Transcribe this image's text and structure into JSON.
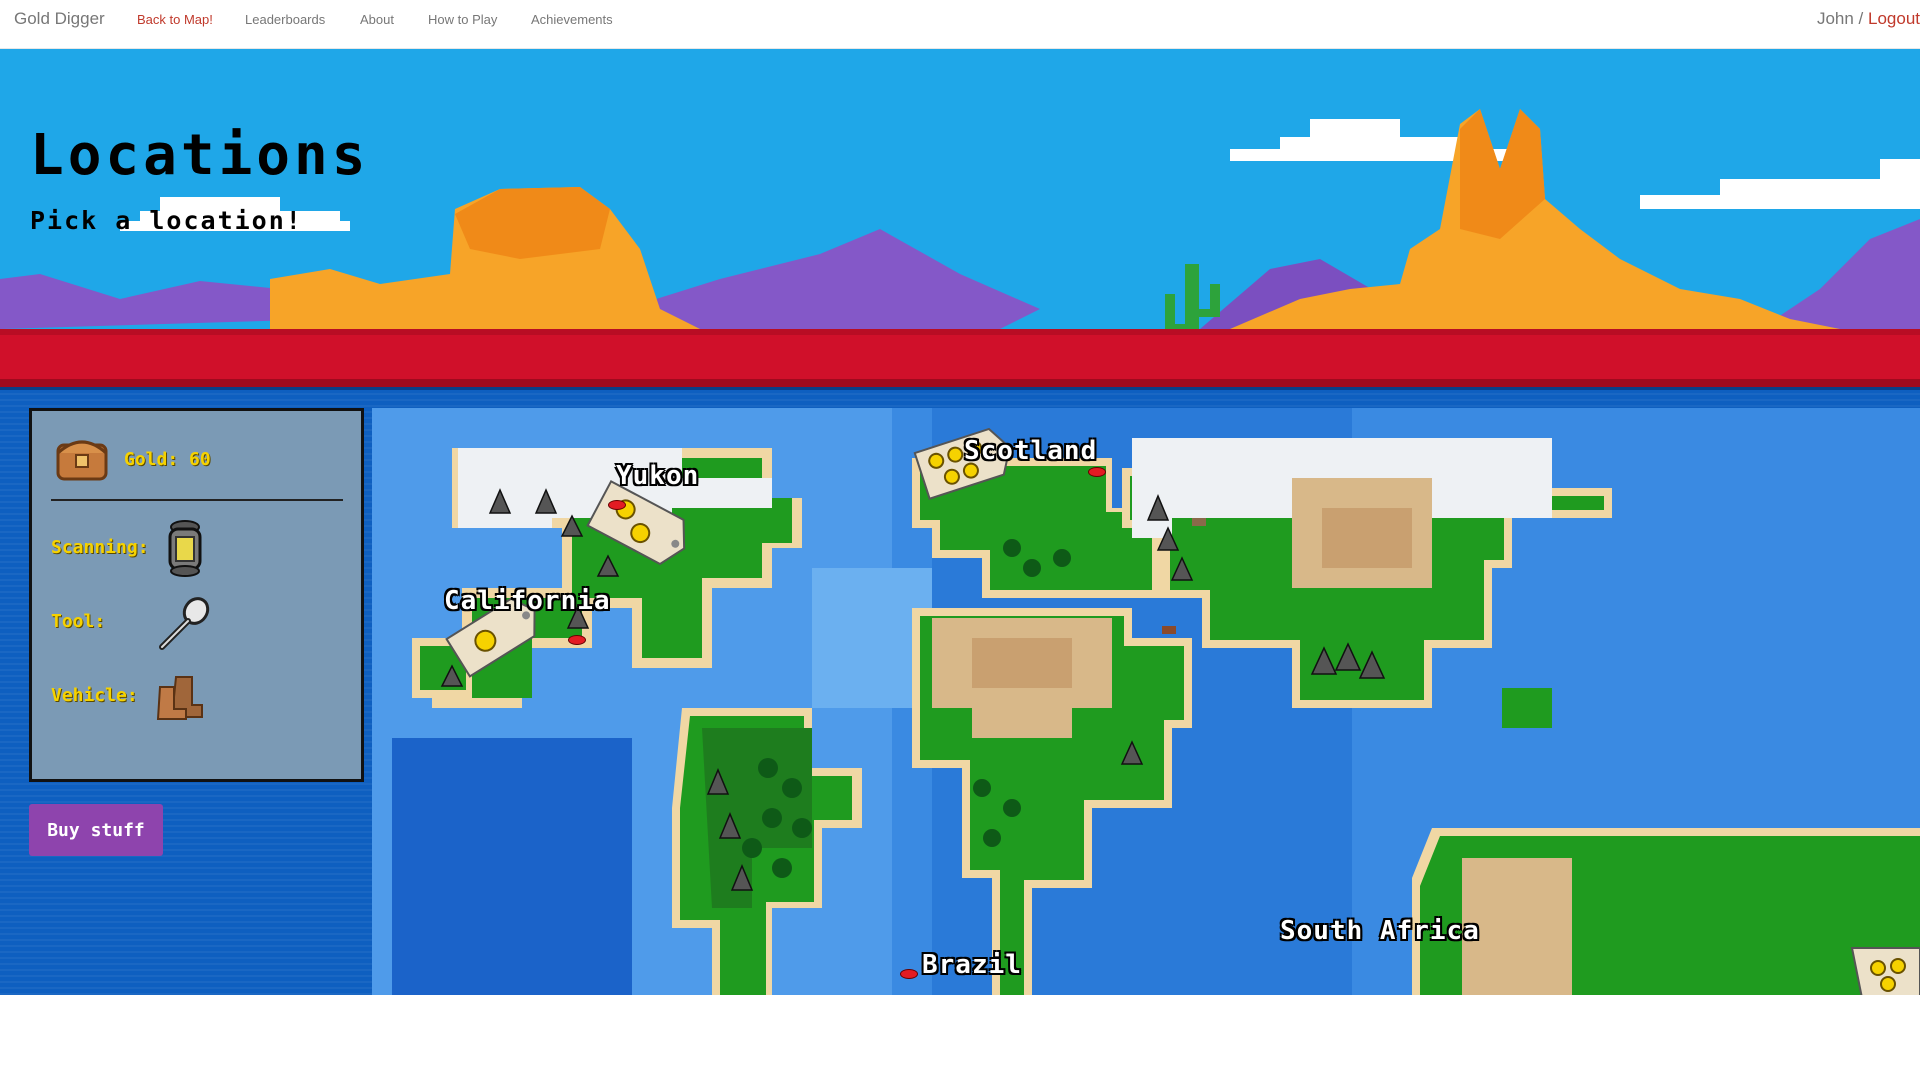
{
  "navbar": {
    "brand": "Gold Digger",
    "links": [
      {
        "label": "Back to Map!",
        "active": true
      },
      {
        "label": "Leaderboards",
        "active": false
      },
      {
        "label": "About",
        "active": false
      },
      {
        "label": "How to Play",
        "active": false
      },
      {
        "label": "Achievements",
        "active": false
      }
    ],
    "user": "John",
    "separator": " / ",
    "logout": "Logout"
  },
  "header": {
    "title": "Locations",
    "subtitle": "Pick a location!"
  },
  "panel": {
    "gold_label": "Gold: 60",
    "scanning_label": "Scanning:",
    "tool_label": "Tool:",
    "vehicle_label": "Vehicle:",
    "icons": {
      "gold": "treasure-chest-icon",
      "scanning": "lantern-icon",
      "tool": "spoon-icon",
      "vehicle": "boots-icon"
    }
  },
  "buy_button": "Buy stuff",
  "locations": [
    {
      "name": "Yukon"
    },
    {
      "name": "California"
    },
    {
      "name": "Scotland"
    },
    {
      "name": "Brazil"
    },
    {
      "name": "South Africa"
    }
  ],
  "colors": {
    "accent_red": "#c0392b",
    "gold_text": "#f6d200",
    "button_purple": "#8e44ad",
    "ocean_deep": "#1b63c9",
    "ocean_light": "#5fa8ee",
    "land_green": "#1f9b1f",
    "sand": "#e8c98f",
    "desert_red": "#d0102a"
  }
}
